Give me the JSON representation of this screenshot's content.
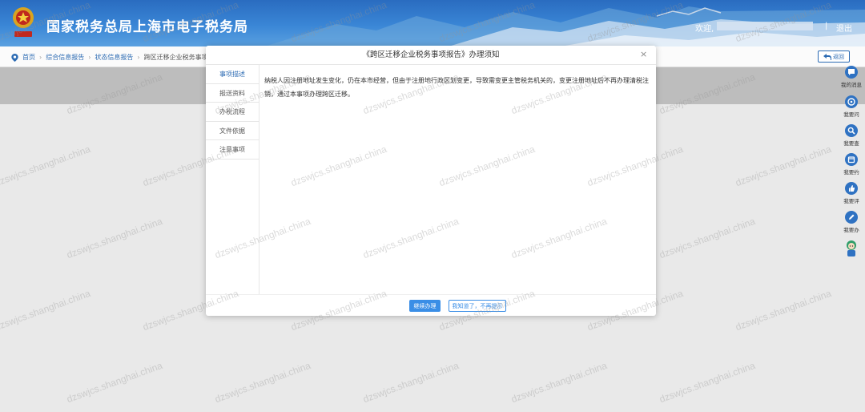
{
  "header": {
    "site_title": "国家税务总局上海市电子税务局",
    "welcome": "欢迎,",
    "separator": "|",
    "logout": "退出"
  },
  "breadcrumb": {
    "items": [
      "首页",
      "综合信息报告",
      "状态信息报告",
      "跨区迁移企业税务事项"
    ],
    "back": "返回"
  },
  "right_tools": [
    {
      "label": "我的消息",
      "icon": "chat-icon"
    },
    {
      "label": "我要问",
      "icon": "question-icon"
    },
    {
      "label": "我要查",
      "icon": "search-icon"
    },
    {
      "label": "我要约",
      "icon": "calendar-icon"
    },
    {
      "label": "我要评",
      "icon": "thumb-icon"
    },
    {
      "label": "我要办",
      "icon": "pen-icon"
    }
  ],
  "modal": {
    "title": "《跨区迁移企业税务事项报告》办理须知",
    "close": "×",
    "tabs": [
      "事项描述",
      "报送资料",
      "办税流程",
      "文件依据",
      "注意事项"
    ],
    "active_tab": 0,
    "description": "纳税人因注册地址发生变化，仍在本市经营，但由于注册地行政区划变更，导致需变更主管税务机关的，变更注册地址后不再办理清税注销，通过本事项办理跨区迁移。",
    "primary_button": "继续办理",
    "secondary_button": "我知道了，不再提示"
  },
  "watermark": "dzswjcs.shanghai.china",
  "colors": {
    "brand_blue": "#2c6bb3",
    "button_blue": "#3a8ee6",
    "header_blue": "#3a86d6"
  }
}
